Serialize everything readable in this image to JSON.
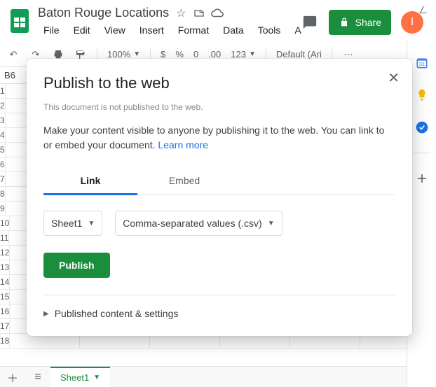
{
  "header": {
    "doc_title": "Baton Rouge Locations",
    "menus": [
      "File",
      "Edit",
      "View",
      "Insert",
      "Format",
      "Data",
      "Tools",
      "A"
    ],
    "share_label": "Share",
    "avatar_initial": "I"
  },
  "toolbar": {
    "zoom": "100%",
    "currency": "$",
    "percent": "%",
    "dec_remove": "0",
    "dec_add": ".00",
    "num_format": "123",
    "font_name": "Default (Ari"
  },
  "formula_bar": {
    "cell_ref": "B6"
  },
  "grid": {
    "visible_row_numbers": [
      1,
      2,
      3,
      4,
      5,
      6,
      7,
      8,
      9,
      10,
      11,
      12,
      13,
      14,
      15,
      16,
      17,
      18
    ]
  },
  "sheet_tabs": {
    "active": "Sheet1"
  },
  "dialog": {
    "title": "Publish to the web",
    "not_published_note": "This document is not published to the web.",
    "description_prefix": "Make your content visible to anyone by publishing it to the web. You can link to or embed your document. ",
    "learn_more": "Learn more",
    "tabs": {
      "link": "Link",
      "embed": "Embed"
    },
    "sheet_dropdown": "Sheet1",
    "format_dropdown": "Comma-separated values (.csv)",
    "publish_button": "Publish",
    "expander": "Published content & settings"
  },
  "side_icons": [
    "calendar-icon",
    "keep-icon",
    "tasks-icon",
    "add-icon"
  ]
}
